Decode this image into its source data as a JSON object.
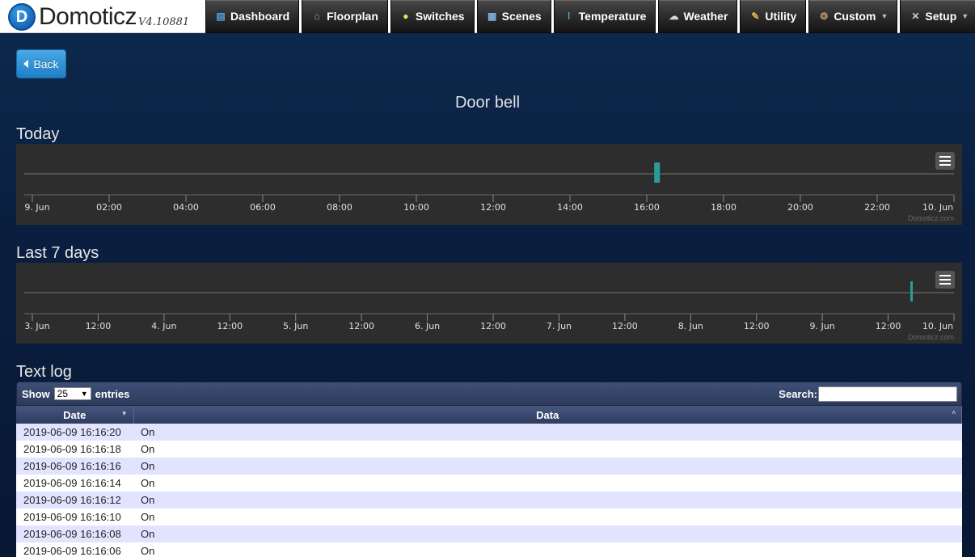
{
  "app": {
    "name": "Domoticz",
    "version": "V4.10881",
    "logo_letter": "D"
  },
  "nav": [
    {
      "label": "Dashboard",
      "icon": "dashboard-icon",
      "glyph": "▤",
      "color": "#4fa3e0"
    },
    {
      "label": "Floorplan",
      "icon": "house-icon",
      "glyph": "⌂",
      "color": "#9ab0cf"
    },
    {
      "label": "Switches",
      "icon": "lightbulb-icon",
      "glyph": "●",
      "color": "#f0e060"
    },
    {
      "label": "Scenes",
      "icon": "clapper-icon",
      "glyph": "▦",
      "color": "#7fb0e0"
    },
    {
      "label": "Temperature",
      "icon": "thermometer-icon",
      "glyph": "ǀ",
      "color": "#4fa3e0"
    },
    {
      "label": "Weather",
      "icon": "cloud-icon",
      "glyph": "☁",
      "color": "#d0d8e8"
    },
    {
      "label": "Utility",
      "icon": "utility-icon",
      "glyph": "✎",
      "color": "#e0c040"
    },
    {
      "label": "Custom",
      "icon": "gear-icon",
      "glyph": "⚙",
      "color": "#c9a86a",
      "dropdown": true
    },
    {
      "label": "Setup",
      "icon": "tools-icon",
      "glyph": "✕",
      "color": "#d0d0d0",
      "dropdown": true
    }
  ],
  "back_label": "Back",
  "page_title": "Door bell",
  "today": {
    "title": "Today",
    "tick_labels": [
      "9. Jun",
      "02:00",
      "04:00",
      "06:00",
      "08:00",
      "10:00",
      "12:00",
      "14:00",
      "16:00",
      "18:00",
      "20:00",
      "22:00",
      "10. Jun"
    ],
    "credit": "Domoticz.com"
  },
  "week": {
    "title": "Last 7 days",
    "tick_labels": [
      "3. Jun",
      "12:00",
      "4. Jun",
      "12:00",
      "5. Jun",
      "12:00",
      "6. Jun",
      "12:00",
      "7. Jun",
      "12:00",
      "8. Jun",
      "12:00",
      "9. Jun",
      "12:00",
      "10. Jun"
    ],
    "credit": "Domoticz.com"
  },
  "chart_data": [
    {
      "type": "bar",
      "title": "Today",
      "x_range": [
        "2019-06-09 00:00",
        "2019-06-10 00:00"
      ],
      "events": [
        {
          "x": "2019-06-09 16:16",
          "value": "On"
        }
      ],
      "series_color": "#2a9d9b"
    },
    {
      "type": "bar",
      "title": "Last 7 days",
      "x_range": [
        "2019-06-03 00:00",
        "2019-06-10 00:00"
      ],
      "events": [
        {
          "x": "2019-06-09 16:16",
          "value": "On"
        }
      ],
      "series_color": "#2a9d9b"
    }
  ],
  "text_log": {
    "title": "Text log",
    "show_label": "Show",
    "entries_select": "25",
    "entries_label": "entries",
    "search_label": "Search:",
    "columns": [
      "Date",
      "Data"
    ],
    "rows": [
      [
        "2019-06-09 16:16:20",
        "On"
      ],
      [
        "2019-06-09 16:16:18",
        "On"
      ],
      [
        "2019-06-09 16:16:16",
        "On"
      ],
      [
        "2019-06-09 16:16:14",
        "On"
      ],
      [
        "2019-06-09 16:16:12",
        "On"
      ],
      [
        "2019-06-09 16:16:10",
        "On"
      ],
      [
        "2019-06-09 16:16:08",
        "On"
      ],
      [
        "2019-06-09 16:16:06",
        "On"
      ]
    ]
  }
}
